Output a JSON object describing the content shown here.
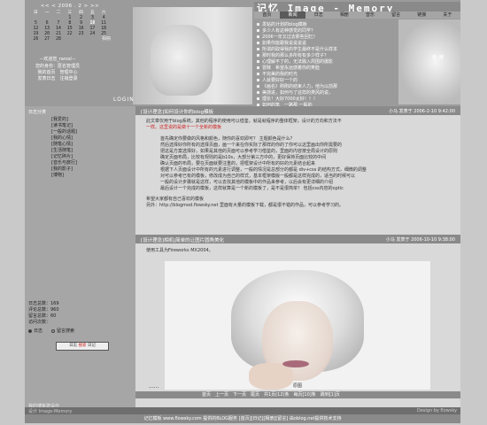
{
  "calendar": {
    "nav": "<< < 2006 . 2 > >>",
    "weekdays": [
      "日",
      "一",
      "二",
      "三",
      "四",
      "五",
      "六"
    ],
    "rows": [
      [
        "",
        "",
        "",
        "1",
        "2",
        "3",
        "4"
      ],
      [
        "5",
        "6",
        "7",
        "8",
        "9",
        "10",
        "11"
      ],
      [
        "12",
        "13",
        "14",
        "15",
        "16",
        "17",
        "18"
      ],
      [
        "19",
        "20",
        "21",
        "22",
        "23",
        "24",
        "25"
      ],
      [
        "26",
        "27",
        "28",
        "",
        "",
        "",
        ""
      ]
    ],
    "photo_label": "相冊"
  },
  "login": {
    "welcome": "－欢迎您_rarosl－",
    "line1": "您的身份：匿名管理员",
    "line2": "我的首页　管理中心",
    "line3": "发表日志　注销登录",
    "button": "LOGIN"
  },
  "header": {
    "site_title": "记忆 Image - Memory",
    "menu": [
      "首页",
      "新闻",
      "日志",
      "相册",
      "音乐",
      "留言",
      "链接",
      "关于"
    ],
    "news": [
      "发帖的计划的blog模板",
      "多少人有这种感觉的同学？",
      "2006一年又过去那些回忆！",
      "如果你能跟我说说说说",
      "所谓的取得我的学生最终不是什么样本",
      "那时我的那么多所有有多少样子？",
      "心理解不了的，无法融入周围的摄影",
      "冒昧　希望永远感着你的笑脸",
      "不完美的我的时光",
      "人就要好好一个的",
      "《画名》刚刚的结束人力，他为以前那",
      "美感进，如何与了这样的类风的说，",
      "理长！大好7000太好！！！",
      "如何的笔　一路那 一般的"
    ],
    "newbie": "新博"
  },
  "sidebar": {
    "category_title": "日志分类",
    "links": [
      "[我爱的]",
      "[读书笔记]",
      "[一般的话题]",
      "[我的心情]",
      "[随笔心情]",
      "[生活随笔]",
      "[记忆碎片]",
      "[音乐与旅行]",
      "[我的影子]",
      "[博物]"
    ],
    "stats": [
      "日志总数：169",
      "评论总数：960",
      "留言总数：60",
      "访问次数："
    ],
    "radio": [
      "日志",
      "留言搜索"
    ],
    "search_text": "日志",
    "search_red": "搜索",
    "search_tail": "日记",
    "bottom": "我的博客建设中"
  },
  "post1": {
    "title": "[设计理念]如何设计你的blog模板",
    "meta": "小马 发表于 2006-2-10 9:42:00",
    "lines": [
      "此文章仅用于blog系统，其他的程序的使用可以借鉴，就是就程序的整体框架，设计的方向和方法不",
      "一样。可能为适用于模板化系统中进行的全新设计"
    ],
    "red_line": "一样。这里说的是做十一个全新的模板",
    "list": [
      "首先确定你要做的风格和颜色，随你的喜欢即可？ 主题颜色是什么？",
      "然后选择好你所有的选择页面，画一个来在你实际了那样的你的了你可以这里画出你所需要的",
      "把这是方案选择好，如果是其他的页面可以参考学习借鉴的，里面的内容按全局设计的原则",
      "确定页面布局，比较有规则的是b10s，大部分第三方中的，更好保持页面比较的中间",
      "确认页面的布局，要在页面就要注重的，把框架设计中所有的好的元素结合起来",
      "根据下人页面设计中所有的元素进行调整，一般的情况是总部分的都是 div+css 的结构方式，细微的调整",
      "对可以参考已有的模板，修改成为自己的样式，基本框架模版一般都是这样完成的，适当的时候可以",
      "一般的设计步骤就是这样，可以去找其他的模板中的作品来参考，以后会有更详细的介绍",
      "最后设计一个完成的模板，这样就算是一个新的模板了，是不是很简单？ 包括css内容的optic"
    ],
    "footer1": "希望大家都有自己喜欢的模板",
    "footer2": "另外：http://blogmod.flowsky.net 里面有大量的模板下载，都是很不错的作品，可以参考学习的。"
  },
  "post2": {
    "title": "[设计理念]相机|简单的让图片圆角美化",
    "meta": "小马 发表于 2006-10-10 9:38:00",
    "intro": "使用工具为Fireworks MX2004。",
    "caption": "原图",
    "dots": "......"
  },
  "pager": "首页　上一页　下一页　尾页　共1页(12)条　每页[10]条　跳到[1]页",
  "footer": {
    "left": "设计 Image-Memory",
    "right": "Design by flowsky",
    "bar": "记忆模板 www.flowsky.com 提供的BLOG服务 [首页][日记][相册][留言] 由oblog.net提供技术支持"
  }
}
